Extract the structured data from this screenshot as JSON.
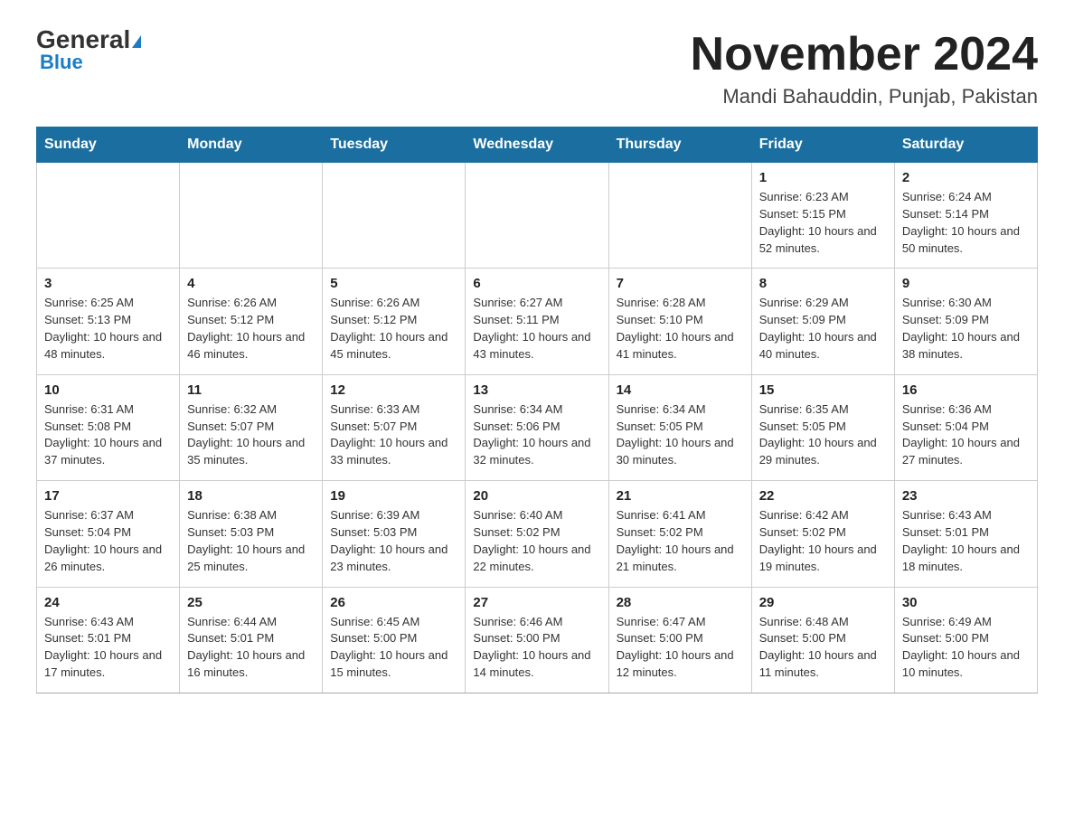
{
  "header": {
    "logo_general": "General",
    "logo_blue": "Blue",
    "month_title": "November 2024",
    "location": "Mandi Bahauddin, Punjab, Pakistan"
  },
  "days_of_week": [
    "Sunday",
    "Monday",
    "Tuesday",
    "Wednesday",
    "Thursday",
    "Friday",
    "Saturday"
  ],
  "weeks": [
    [
      {
        "day": "",
        "info": ""
      },
      {
        "day": "",
        "info": ""
      },
      {
        "day": "",
        "info": ""
      },
      {
        "day": "",
        "info": ""
      },
      {
        "day": "",
        "info": ""
      },
      {
        "day": "1",
        "info": "Sunrise: 6:23 AM\nSunset: 5:15 PM\nDaylight: 10 hours and 52 minutes."
      },
      {
        "day": "2",
        "info": "Sunrise: 6:24 AM\nSunset: 5:14 PM\nDaylight: 10 hours and 50 minutes."
      }
    ],
    [
      {
        "day": "3",
        "info": "Sunrise: 6:25 AM\nSunset: 5:13 PM\nDaylight: 10 hours and 48 minutes."
      },
      {
        "day": "4",
        "info": "Sunrise: 6:26 AM\nSunset: 5:12 PM\nDaylight: 10 hours and 46 minutes."
      },
      {
        "day": "5",
        "info": "Sunrise: 6:26 AM\nSunset: 5:12 PM\nDaylight: 10 hours and 45 minutes."
      },
      {
        "day": "6",
        "info": "Sunrise: 6:27 AM\nSunset: 5:11 PM\nDaylight: 10 hours and 43 minutes."
      },
      {
        "day": "7",
        "info": "Sunrise: 6:28 AM\nSunset: 5:10 PM\nDaylight: 10 hours and 41 minutes."
      },
      {
        "day": "8",
        "info": "Sunrise: 6:29 AM\nSunset: 5:09 PM\nDaylight: 10 hours and 40 minutes."
      },
      {
        "day": "9",
        "info": "Sunrise: 6:30 AM\nSunset: 5:09 PM\nDaylight: 10 hours and 38 minutes."
      }
    ],
    [
      {
        "day": "10",
        "info": "Sunrise: 6:31 AM\nSunset: 5:08 PM\nDaylight: 10 hours and 37 minutes."
      },
      {
        "day": "11",
        "info": "Sunrise: 6:32 AM\nSunset: 5:07 PM\nDaylight: 10 hours and 35 minutes."
      },
      {
        "day": "12",
        "info": "Sunrise: 6:33 AM\nSunset: 5:07 PM\nDaylight: 10 hours and 33 minutes."
      },
      {
        "day": "13",
        "info": "Sunrise: 6:34 AM\nSunset: 5:06 PM\nDaylight: 10 hours and 32 minutes."
      },
      {
        "day": "14",
        "info": "Sunrise: 6:34 AM\nSunset: 5:05 PM\nDaylight: 10 hours and 30 minutes."
      },
      {
        "day": "15",
        "info": "Sunrise: 6:35 AM\nSunset: 5:05 PM\nDaylight: 10 hours and 29 minutes."
      },
      {
        "day": "16",
        "info": "Sunrise: 6:36 AM\nSunset: 5:04 PM\nDaylight: 10 hours and 27 minutes."
      }
    ],
    [
      {
        "day": "17",
        "info": "Sunrise: 6:37 AM\nSunset: 5:04 PM\nDaylight: 10 hours and 26 minutes."
      },
      {
        "day": "18",
        "info": "Sunrise: 6:38 AM\nSunset: 5:03 PM\nDaylight: 10 hours and 25 minutes."
      },
      {
        "day": "19",
        "info": "Sunrise: 6:39 AM\nSunset: 5:03 PM\nDaylight: 10 hours and 23 minutes."
      },
      {
        "day": "20",
        "info": "Sunrise: 6:40 AM\nSunset: 5:02 PM\nDaylight: 10 hours and 22 minutes."
      },
      {
        "day": "21",
        "info": "Sunrise: 6:41 AM\nSunset: 5:02 PM\nDaylight: 10 hours and 21 minutes."
      },
      {
        "day": "22",
        "info": "Sunrise: 6:42 AM\nSunset: 5:02 PM\nDaylight: 10 hours and 19 minutes."
      },
      {
        "day": "23",
        "info": "Sunrise: 6:43 AM\nSunset: 5:01 PM\nDaylight: 10 hours and 18 minutes."
      }
    ],
    [
      {
        "day": "24",
        "info": "Sunrise: 6:43 AM\nSunset: 5:01 PM\nDaylight: 10 hours and 17 minutes."
      },
      {
        "day": "25",
        "info": "Sunrise: 6:44 AM\nSunset: 5:01 PM\nDaylight: 10 hours and 16 minutes."
      },
      {
        "day": "26",
        "info": "Sunrise: 6:45 AM\nSunset: 5:00 PM\nDaylight: 10 hours and 15 minutes."
      },
      {
        "day": "27",
        "info": "Sunrise: 6:46 AM\nSunset: 5:00 PM\nDaylight: 10 hours and 14 minutes."
      },
      {
        "day": "28",
        "info": "Sunrise: 6:47 AM\nSunset: 5:00 PM\nDaylight: 10 hours and 12 minutes."
      },
      {
        "day": "29",
        "info": "Sunrise: 6:48 AM\nSunset: 5:00 PM\nDaylight: 10 hours and 11 minutes."
      },
      {
        "day": "30",
        "info": "Sunrise: 6:49 AM\nSunset: 5:00 PM\nDaylight: 10 hours and 10 minutes."
      }
    ]
  ]
}
